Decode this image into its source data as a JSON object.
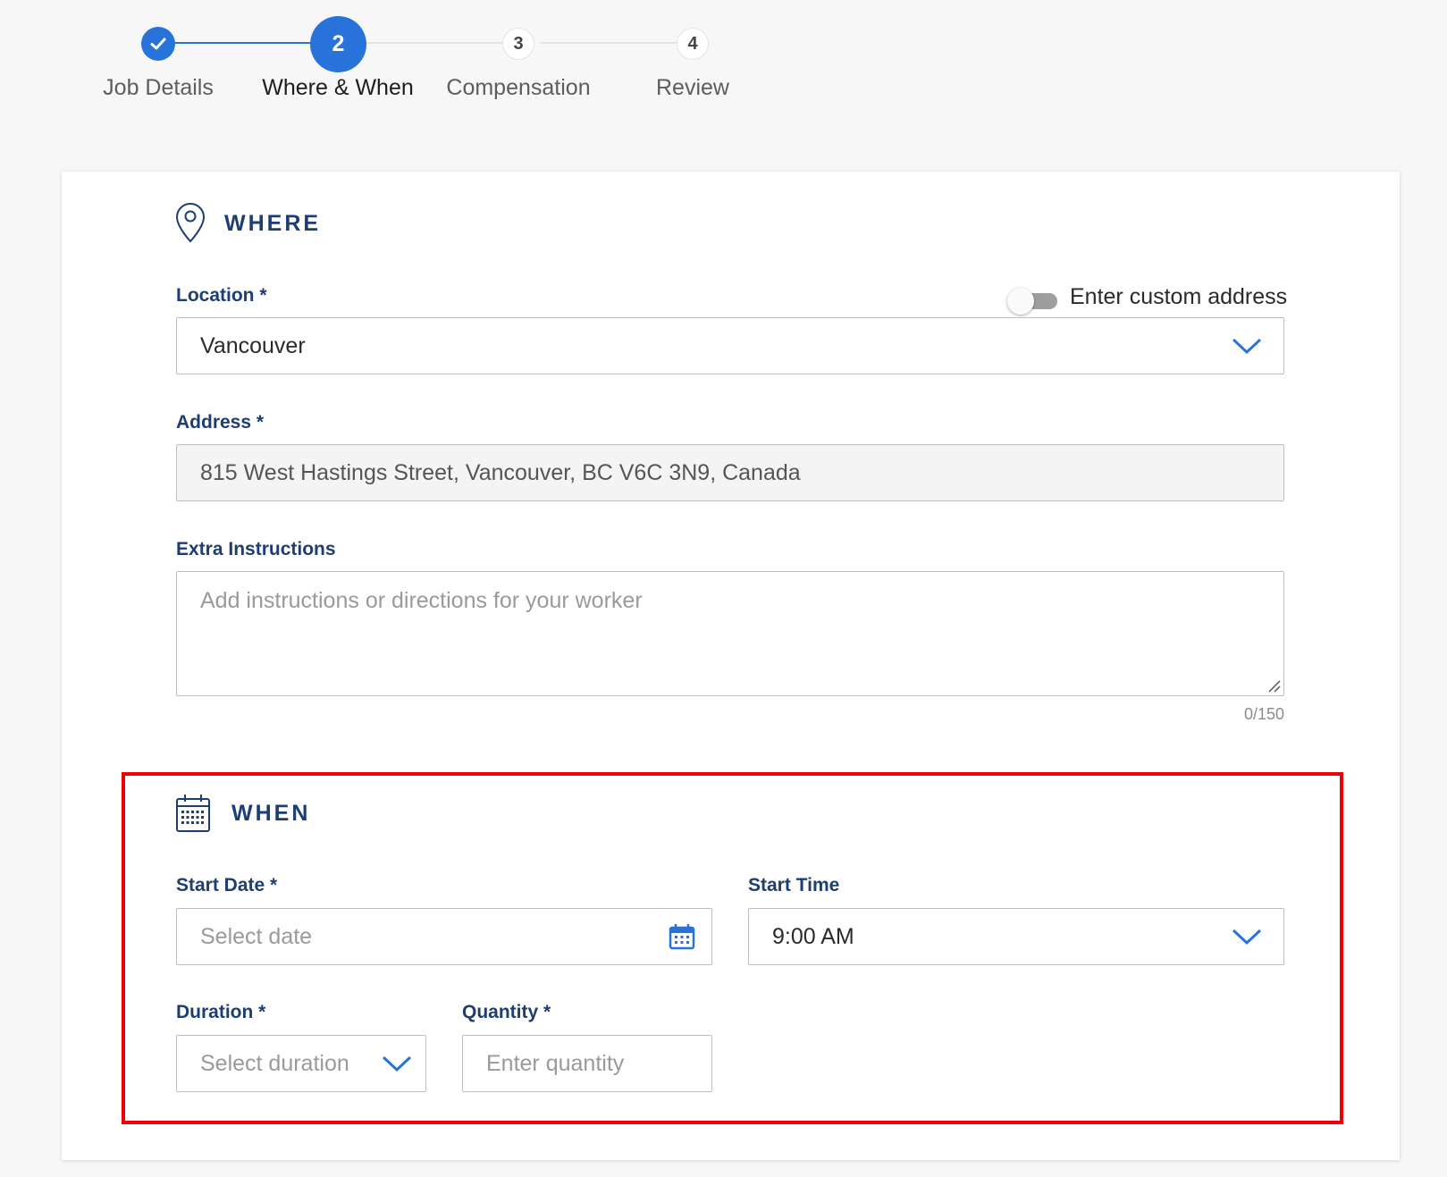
{
  "stepper": {
    "steps": [
      {
        "number": "",
        "label": "Job Details",
        "state": "complete"
      },
      {
        "number": "2",
        "label": "Where & When",
        "state": "active"
      },
      {
        "number": "3",
        "label": "Compensation",
        "state": "upcoming"
      },
      {
        "number": "4",
        "label": "Review",
        "state": "upcoming"
      }
    ]
  },
  "where": {
    "title": "WHERE",
    "location": {
      "label": "Location",
      "required": "*",
      "value": "Vancouver"
    },
    "custom_address_toggle": {
      "label": "Enter custom address"
    },
    "address": {
      "label": "Address",
      "required": "*",
      "value": "815 West Hastings Street, Vancouver, BC V6C 3N9, Canada"
    },
    "extra_instructions": {
      "label": "Extra Instructions",
      "placeholder": "Add instructions or directions for your worker",
      "counter": "0/150"
    }
  },
  "when": {
    "title": "WHEN",
    "start_date": {
      "label": "Start Date",
      "required": "*",
      "placeholder": "Select date"
    },
    "start_time": {
      "label": "Start Time",
      "value": "9:00 AM"
    },
    "duration": {
      "label": "Duration",
      "required": "*",
      "placeholder": "Select duration"
    },
    "quantity": {
      "label": "Quantity",
      "required": "*",
      "placeholder": "Enter quantity"
    }
  },
  "colors": {
    "accent": "#2773d9",
    "heading": "#1d3e72",
    "highlight": "#f00006"
  }
}
